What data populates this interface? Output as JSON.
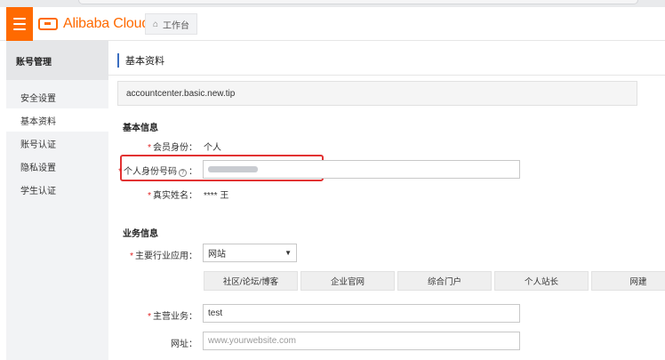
{
  "header": {
    "brand": "Alibaba Cloud",
    "home_tab": "工作台",
    "colors": {
      "brand": "#ff6a00"
    }
  },
  "sidebar": {
    "title": "账号管理",
    "items": [
      {
        "label": "安全设置",
        "active": false
      },
      {
        "label": "基本资料",
        "active": true
      },
      {
        "label": "账号认证",
        "active": false
      },
      {
        "label": "隐私设置",
        "active": false
      },
      {
        "label": "学生认证",
        "active": false
      }
    ]
  },
  "main": {
    "page_title": "基本资料",
    "tip": "accountcenter.basic.new.tip",
    "basic_info": {
      "heading": "基本信息",
      "member_label": "会员身份：",
      "member_value": "个人",
      "id_label": "个人身份号码",
      "id_help": "?",
      "id_colon": "：",
      "name_label": "真实姓名：",
      "name_value": "**** 王"
    },
    "business_info": {
      "heading": "业务信息",
      "industry_label": "主要行业应用：",
      "industry_selected": "网站",
      "categories": [
        "社区/论坛/博客",
        "企业官网",
        "综合门户",
        "个人站长",
        "网建"
      ],
      "main_business_label": "主营业务：",
      "main_business_value": "test",
      "url_label": "网址：",
      "url_placeholder": "www.yourwebsite.com"
    }
  }
}
